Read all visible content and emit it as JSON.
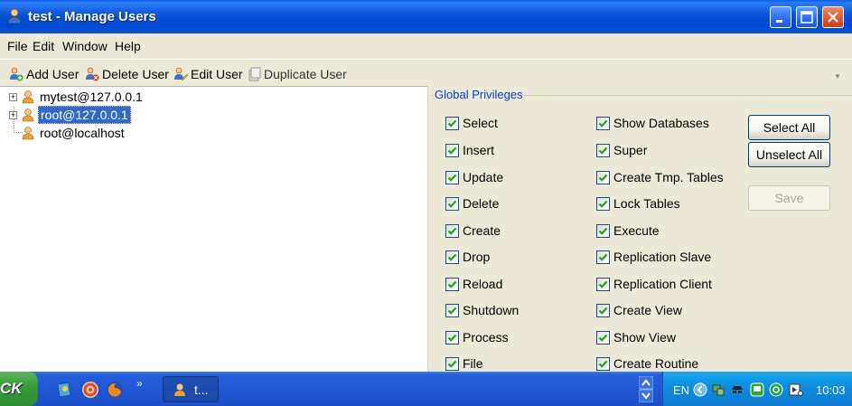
{
  "window": {
    "title": "test - Manage Users"
  },
  "menu": [
    "File",
    "Edit",
    "Window",
    "Help"
  ],
  "toolbar": {
    "add_user": "Add User",
    "delete_user": "Delete User",
    "edit_user": "Edit User",
    "duplicate_user": "Duplicate User"
  },
  "tree": {
    "items": [
      {
        "label": "mytest@127.0.0.1",
        "expandable": true,
        "selected": false
      },
      {
        "label": "root@127.0.0.1",
        "expandable": true,
        "selected": true
      },
      {
        "label": "root@localhost",
        "expandable": false,
        "selected": false
      }
    ]
  },
  "privileges": {
    "group_title": "Global Privileges",
    "left_column": [
      {
        "label": "Select",
        "checked": true
      },
      {
        "label": "Insert",
        "checked": true
      },
      {
        "label": "Update",
        "checked": true
      },
      {
        "label": "Delete",
        "checked": true
      },
      {
        "label": "Create",
        "checked": true
      },
      {
        "label": "Drop",
        "checked": true
      },
      {
        "label": "Reload",
        "checked": true
      },
      {
        "label": "Shutdown",
        "checked": true
      },
      {
        "label": "Process",
        "checked": true
      },
      {
        "label": "File",
        "checked": true
      }
    ],
    "right_column": [
      {
        "label": "Show Databases",
        "checked": true
      },
      {
        "label": "Super",
        "checked": true
      },
      {
        "label": "Create Tmp. Tables",
        "checked": true
      },
      {
        "label": "Lock Tables",
        "checked": true
      },
      {
        "label": "Execute",
        "checked": true
      },
      {
        "label": "Replication Slave",
        "checked": true
      },
      {
        "label": "Replication Client",
        "checked": true
      },
      {
        "label": "Create View",
        "checked": true
      },
      {
        "label": "Show View",
        "checked": true
      },
      {
        "label": "Create Routine",
        "checked": true
      }
    ],
    "buttons": {
      "select_all": "Select All",
      "unselect_all": "Unselect All",
      "save": "Save"
    }
  },
  "taskbar": {
    "start_label": "CK",
    "task_label": "t...",
    "language": "EN",
    "clock": "10:03"
  }
}
